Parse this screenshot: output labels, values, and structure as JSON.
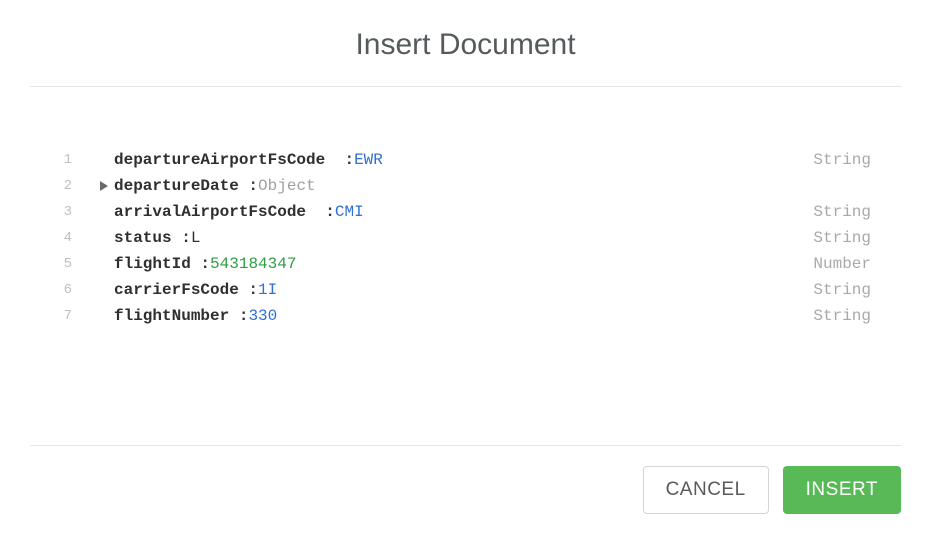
{
  "title": "Insert Document",
  "fields": [
    {
      "line": "1",
      "key": "departureAirportFsCode ",
      "gap": " ",
      "value": "EWR",
      "vclass": "val-string",
      "type": "String",
      "expandable": false
    },
    {
      "line": "2",
      "key": "departureDate ",
      "gap": "",
      "value": "Object",
      "vclass": "val-object",
      "type": "",
      "expandable": true
    },
    {
      "line": "3",
      "key": "arrivalAirportFsCode ",
      "gap": " ",
      "value": "CMI",
      "vclass": "val-string",
      "type": "String",
      "expandable": false
    },
    {
      "line": "4",
      "key": "status ",
      "gap": "",
      "value": "L",
      "vclass": "val-plain",
      "type": "String",
      "expandable": false
    },
    {
      "line": "5",
      "key": "flightId ",
      "gap": "",
      "value": "543184347",
      "vclass": "val-number",
      "type": "Number",
      "expandable": false
    },
    {
      "line": "6",
      "key": "carrierFsCode ",
      "gap": "",
      "value": "1I",
      "vclass": "val-string",
      "type": "String",
      "expandable": false
    },
    {
      "line": "7",
      "key": "flightNumber ",
      "gap": "",
      "value": "330",
      "vclass": "val-string",
      "type": "String",
      "expandable": false
    }
  ],
  "buttons": {
    "cancel": "CANCEL",
    "insert": "INSERT"
  }
}
